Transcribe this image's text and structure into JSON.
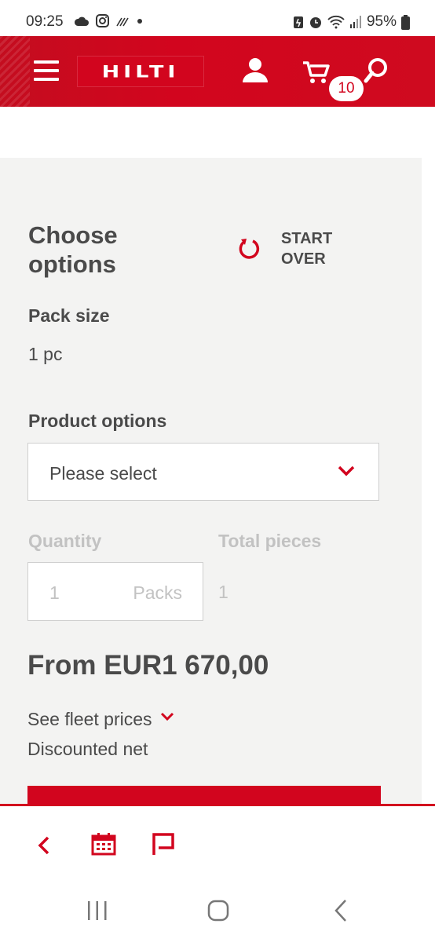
{
  "status_bar": {
    "time": "09:25",
    "battery": "95%",
    "left_icons": [
      "cloud-icon",
      "instagram-icon",
      "activity-icon",
      "dot-icon"
    ],
    "right_icons": [
      "battery-saver-icon",
      "alarm-icon",
      "wifi-icon",
      "signal-icon",
      "battery-icon"
    ]
  },
  "header": {
    "logo_text": "HILTI",
    "cart_count": "10",
    "brand_color": "#d2051e"
  },
  "options": {
    "title": "Choose options",
    "start_over_label": "START OVER",
    "pack_size_label": "Pack size",
    "pack_size_value": "1 pc",
    "product_options_label": "Product options",
    "product_options_placeholder": "Please select",
    "quantity_label": "Quantity",
    "quantity_value": "1",
    "quantity_unit": "Packs",
    "total_pieces_label": "Total pieces",
    "total_pieces_value": "1",
    "price": "From EUR1 670,00",
    "fleet_prices_label": "See fleet prices",
    "discounted_label": "Discounted net"
  },
  "bottom_toolbar": {
    "icons": [
      "back-icon",
      "calendar-icon",
      "flag-icon"
    ]
  },
  "nav_bar": {
    "icons": [
      "recents-icon",
      "home-icon",
      "back-icon"
    ]
  }
}
